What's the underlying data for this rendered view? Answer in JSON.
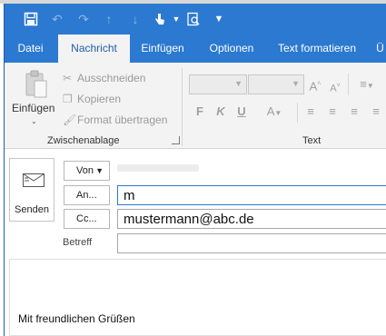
{
  "ribbon_tabs": [
    "Datei",
    "Nachricht",
    "Einfügen",
    "Optionen",
    "Text formatieren",
    "Ü"
  ],
  "active_tab": "Nachricht",
  "clipboard": {
    "paste_label": "Einfügen",
    "cut_label": "Ausschneiden",
    "copy_label": "Kopieren",
    "format_painter_label": "Format übertragen",
    "group_label": "Zwischenablage"
  },
  "text_group": {
    "group_label": "Text",
    "bold": "F",
    "italic": "K",
    "underline": "U",
    "grow_font": "A",
    "shrink_font": "A",
    "font_color": "A"
  },
  "compose": {
    "send_label": "Senden",
    "from_label": "Von",
    "to_label": "An...",
    "to_value": "m",
    "cc_label": "Cc...",
    "cc_value": "mustermann@abc.de",
    "subject_label": "Betreff",
    "subject_value": "",
    "signature": "Mit freundlichen Grüßen"
  },
  "colors": {
    "accent": "#2b79d0",
    "ribbon_bg": "#f3f3f3"
  },
  "icons": [
    "save-icon",
    "undo-icon",
    "redo-icon",
    "up-arrow-icon",
    "down-arrow-icon",
    "touch-mode-icon",
    "print-preview-icon",
    "customize-toolbar-icon",
    "paste-icon",
    "scissors-icon",
    "copy-icon",
    "format-painter-icon",
    "envelope-icon"
  ]
}
